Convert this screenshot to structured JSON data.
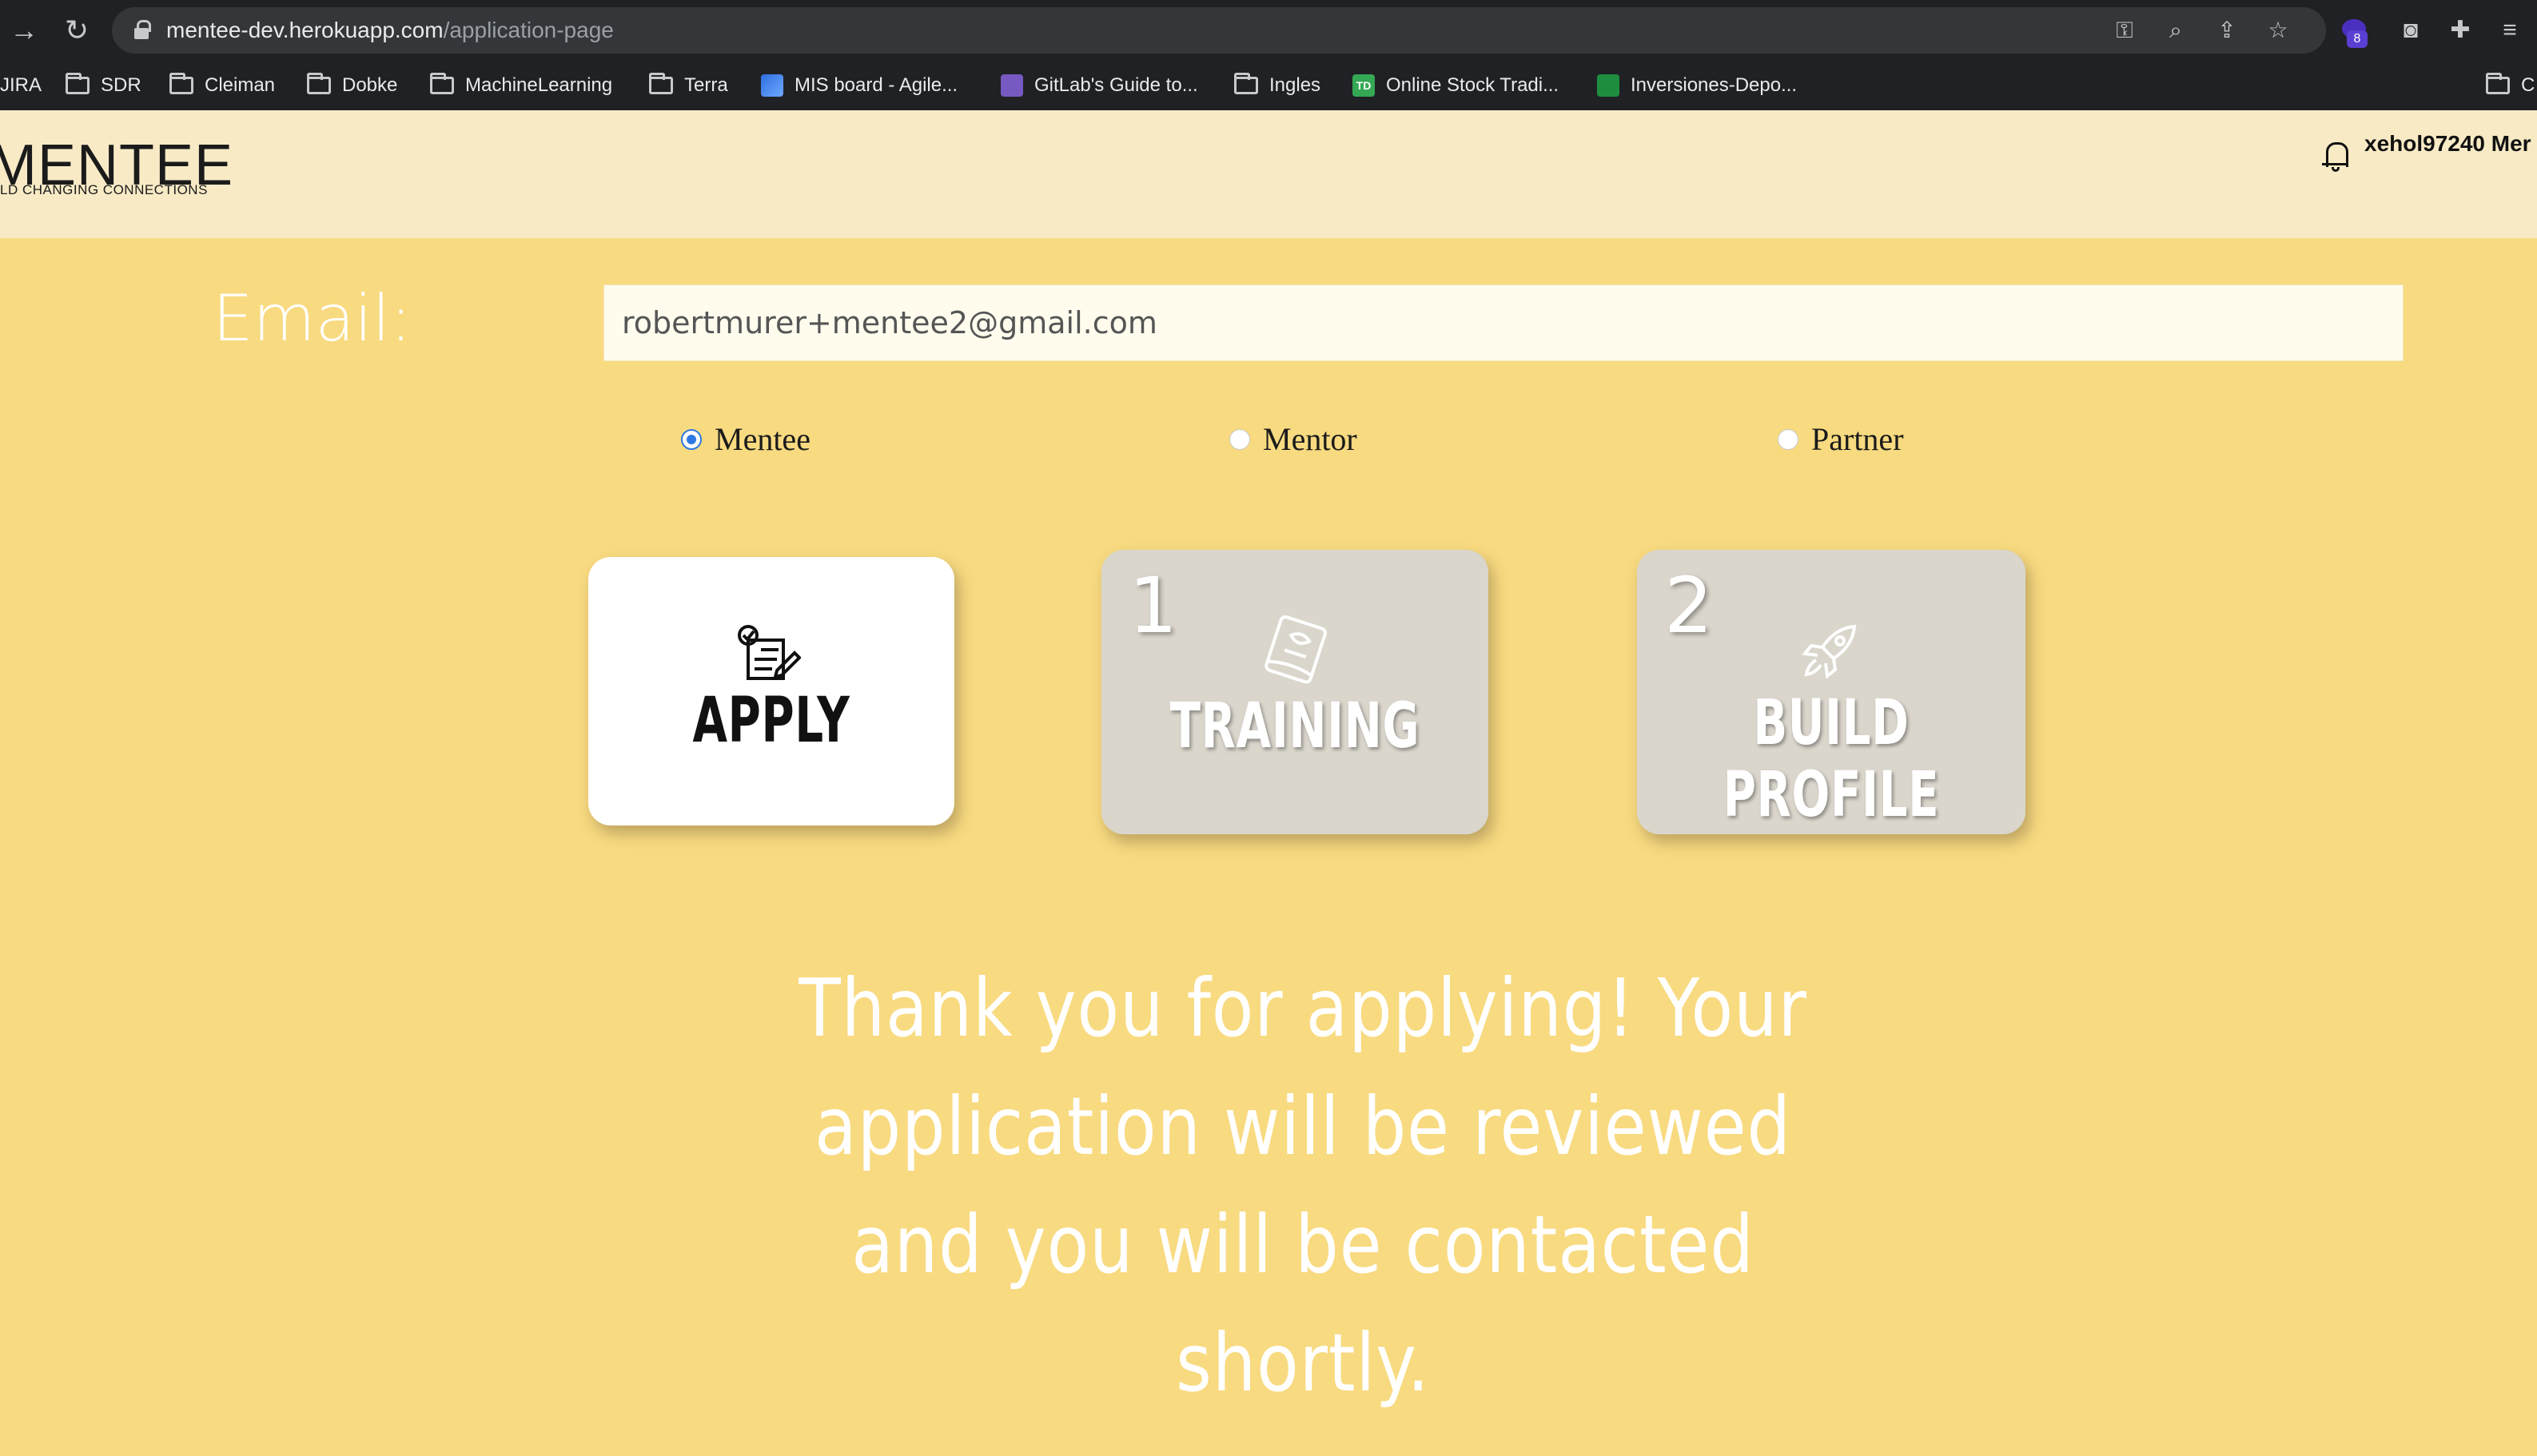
{
  "browser": {
    "url_host": "mentee-dev.herokuapp.com",
    "url_path": "/application-page",
    "bookmarks": [
      {
        "label": "JIRA",
        "icon": "folder-icon"
      },
      {
        "label": "SDR",
        "icon": "folder-icon"
      },
      {
        "label": "Cleiman",
        "icon": "folder-icon"
      },
      {
        "label": "Dobke",
        "icon": "folder-icon"
      },
      {
        "label": "MachineLearning",
        "icon": "folder-icon"
      },
      {
        "label": "Terra",
        "icon": "folder-icon"
      },
      {
        "label": "MIS board - Agile...",
        "icon": "jira-icon"
      },
      {
        "label": "GitLab's Guide to...",
        "icon": "gitlab-icon"
      },
      {
        "label": "Ingles",
        "icon": "folder-icon"
      },
      {
        "label": "Online Stock Tradi...",
        "icon": "td-icon"
      },
      {
        "label": "Inversiones-Depo...",
        "icon": "sheets-icon"
      },
      {
        "label": "C",
        "icon": "folder-icon"
      }
    ],
    "extension_badge": "8",
    "td_label": "TD"
  },
  "header": {
    "logo": "MENTEE",
    "tagline": "LD CHANGING CONNECTIONS",
    "username": "xehol97240 Mer"
  },
  "form": {
    "email_label": "Email:",
    "email_value": "robertmurer+mentee2@gmail.com",
    "roles": [
      {
        "label": "Mentee",
        "checked": true
      },
      {
        "label": "Mentor",
        "checked": false
      },
      {
        "label": "Partner",
        "checked": false
      }
    ]
  },
  "steps": [
    {
      "number": "",
      "label": "APPLY",
      "icon": "application-icon",
      "active": true
    },
    {
      "number": "1",
      "label": "TRAINING",
      "icon": "book-icon",
      "active": false
    },
    {
      "number": "2",
      "label": "BUILD PROFILE",
      "icon": "rocket-icon",
      "active": false
    }
  ],
  "message": "Thank you for applying! Your application will be reviewed and you will be contacted shortly.",
  "colors": {
    "page_bg": "#f8da80",
    "header_bg": "#f7eac5",
    "active_card": "#ffffff",
    "inactive_card": "#dad6cc",
    "radio_accent": "#2d78e4"
  }
}
